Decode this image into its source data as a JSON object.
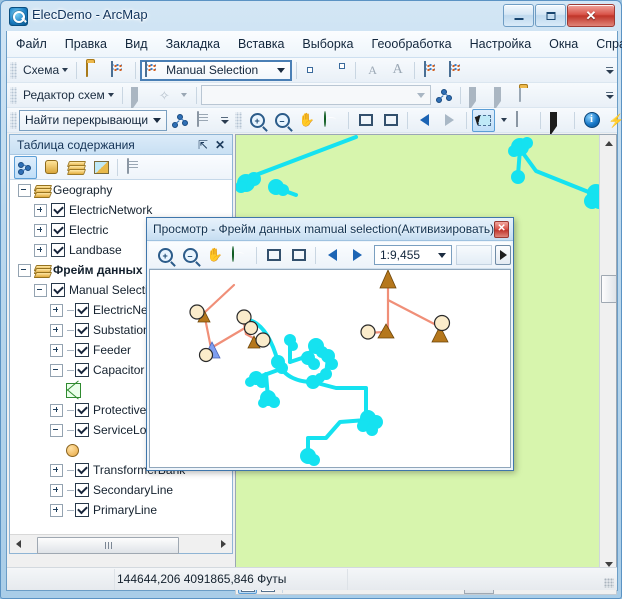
{
  "window": {
    "title": "ElecDemo - ArcMap",
    "icon": "arcmap-icon",
    "buttons": {
      "minimize": "–",
      "maximize": "□",
      "close": "✕"
    }
  },
  "menubar": {
    "items": [
      "Файл",
      "Правка",
      "Вид",
      "Закладка",
      "Вставка",
      "Выборка",
      "Геообработка",
      "Настройка",
      "Окна",
      "Справка"
    ]
  },
  "toolbars": {
    "schematic": {
      "menu_label": "Схема",
      "open_icon": "open-folder-icon",
      "new_diagram_icon": "new-diagram-icon",
      "selection_combo": "Manual Selection",
      "buttons": [
        "zoom-to-selected-icon",
        "pan-to-selected-icon",
        "font-decrease-icon",
        "font-increase-icon",
        "refresh-layout-icon",
        "update-diagram-icon"
      ]
    },
    "schematic_editor": {
      "menu_label": "Редактор схем",
      "buttons": [
        "move-element-icon",
        "magic-wand-icon",
        "link-editor-icon",
        "select-node-icon",
        "select-link-icon",
        "properties-icon"
      ],
      "combo_value": ""
    },
    "find": {
      "combo_value": "Найти перекрывающи",
      "buttons": [
        "network-trace-icon",
        "properties-scroll-icon"
      ]
    },
    "tools": {
      "buttons": [
        "zoom-in-icon",
        "zoom-out-icon",
        "pan-icon",
        "full-extent-icon",
        "fixed-zoom-in-icon",
        "fixed-zoom-out-icon",
        "go-back-icon",
        "go-forward-icon",
        "select-features-icon",
        "select-by-polygon-icon",
        "select-elements-icon",
        "identify-icon",
        "find-icon",
        "html-popup-icon"
      ]
    }
  },
  "toc": {
    "title": "Таблица содержания",
    "pin_icon": "pin-icon",
    "close_icon": "close-icon",
    "toolbar": [
      "list-by-drawing-order-icon",
      "list-by-source-icon",
      "list-by-visibility-icon",
      "list-by-selection-icon",
      "options-icon"
    ],
    "tree": [
      {
        "label": "Geography",
        "level": 0,
        "type": "group",
        "expander": "minus",
        "checkbox": false,
        "bold": false,
        "icon": "layer-stack-icon"
      },
      {
        "label": "ElectricNetwork",
        "level": 1,
        "type": "layer",
        "expander": "plus",
        "checkbox": true
      },
      {
        "label": "Electric",
        "level": 1,
        "type": "layer",
        "expander": "plus",
        "checkbox": true
      },
      {
        "label": "Landbase",
        "level": 1,
        "type": "layer",
        "expander": "plus",
        "checkbox": true
      },
      {
        "label": "Фрейм данных",
        "level": 0,
        "type": "group",
        "expander": "minus",
        "checkbox": false,
        "bold": true,
        "icon": "layer-stack-icon"
      },
      {
        "label": "Manual Selection",
        "level": 1,
        "type": "layer",
        "expander": "minus",
        "checkbox": true
      },
      {
        "label": "ElectricNetwork",
        "level": 2,
        "type": "layer",
        "expander": "plus",
        "checkbox": true
      },
      {
        "label": "Substation",
        "level": 2,
        "type": "layer",
        "expander": "plus",
        "checkbox": true
      },
      {
        "label": "Feeder",
        "level": 2,
        "type": "layer",
        "expander": "plus",
        "checkbox": true
      },
      {
        "label": "Capacitor",
        "level": 2,
        "type": "layer",
        "expander": "minus",
        "checkbox": true
      },
      {
        "label": "",
        "level": 3,
        "type": "symbol",
        "symbol": "green-crossed-box-symbol"
      },
      {
        "label": "ProtectiveDevice",
        "level": 2,
        "type": "layer",
        "expander": "plus",
        "checkbox": true
      },
      {
        "label": "ServiceLocation",
        "level": 2,
        "type": "layer",
        "expander": "minus",
        "checkbox": true
      },
      {
        "label": "",
        "level": 3,
        "type": "symbol",
        "symbol": "orange-circle-symbol"
      },
      {
        "label": "TransformerBank",
        "level": 2,
        "type": "layer",
        "expander": "plus",
        "checkbox": true
      },
      {
        "label": "SecondaryLine",
        "level": 2,
        "type": "layer",
        "expander": "plus",
        "checkbox": true
      },
      {
        "label": "PrimaryLine",
        "level": 2,
        "type": "layer",
        "expander": "plus",
        "checkbox": true
      }
    ]
  },
  "dialog": {
    "title": "Просмотр - Фрейм данных mamual selection(Активизировать)",
    "close_icon": "close-icon",
    "toolbar": [
      "zoom-in-icon",
      "zoom-out-icon",
      "pan-icon",
      "full-extent-icon",
      "fixed-zoom-in-icon",
      "fixed-zoom-out-icon",
      "go-back-icon",
      "go-forward-icon"
    ],
    "scale": "1:9,455",
    "play_icon": "play-icon"
  },
  "mapbar": {
    "buttons": [
      "data-view-icon",
      "layout-view-icon",
      "refresh-icon",
      "pause-drawing-icon"
    ]
  },
  "statusbar": {
    "coordinates": "144644,206  4091865,846 Футы"
  },
  "colors": {
    "map_background": "#d7f5ad",
    "feature_cyan": "#15e2f0",
    "feature_salmon": "#f08f78",
    "node_cream": "#fbeccb",
    "node_brown": "#b5771c",
    "node_blue": "#7f9ff0",
    "accent_blue": "#4a7fb5"
  }
}
